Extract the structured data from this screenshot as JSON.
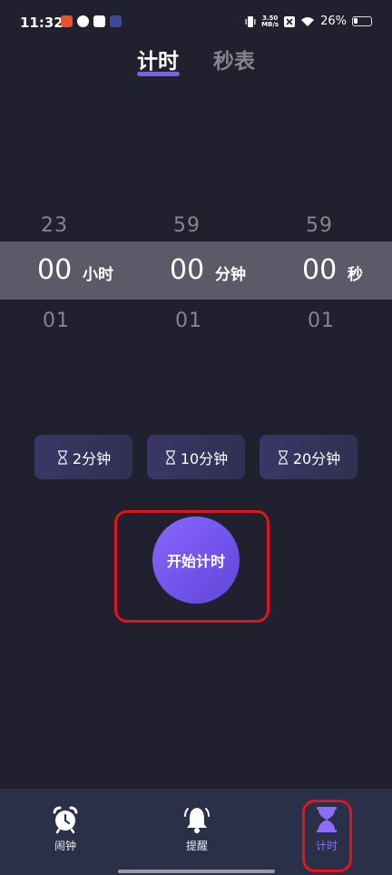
{
  "status_bar": {
    "time": "11:32",
    "net_speed_value": "3.50",
    "net_speed_unit": "MB/s",
    "battery": "26%",
    "battery_level": 0.26
  },
  "tabs": [
    {
      "label": "计时",
      "active": true
    },
    {
      "label": "秒表",
      "active": false
    }
  ],
  "picker": {
    "hours": {
      "above": "23",
      "value": "00",
      "below": "01",
      "unit": "小时"
    },
    "minutes": {
      "above": "59",
      "value": "00",
      "below": "01",
      "unit": "分钟"
    },
    "seconds": {
      "above": "59",
      "value": "00",
      "below": "01",
      "unit": "秒"
    }
  },
  "presets": [
    {
      "label": "2分钟",
      "icon": "hourglass-icon"
    },
    {
      "label": "10分钟",
      "icon": "hourglass-icon"
    },
    {
      "label": "20分钟",
      "icon": "hourglass-icon"
    }
  ],
  "start_button": {
    "label": "开始计时"
  },
  "bottom_nav": [
    {
      "label": "闹钟",
      "icon": "alarm-clock-icon",
      "active": false
    },
    {
      "label": "提醒",
      "icon": "bell-icon",
      "active": false
    },
    {
      "label": "计时",
      "icon": "hourglass-icon",
      "active": true
    }
  ],
  "colors": {
    "background": "#20202f",
    "accent": "#7a5ff0",
    "annotation": "#e0141f",
    "nav_background": "#2b3049"
  }
}
